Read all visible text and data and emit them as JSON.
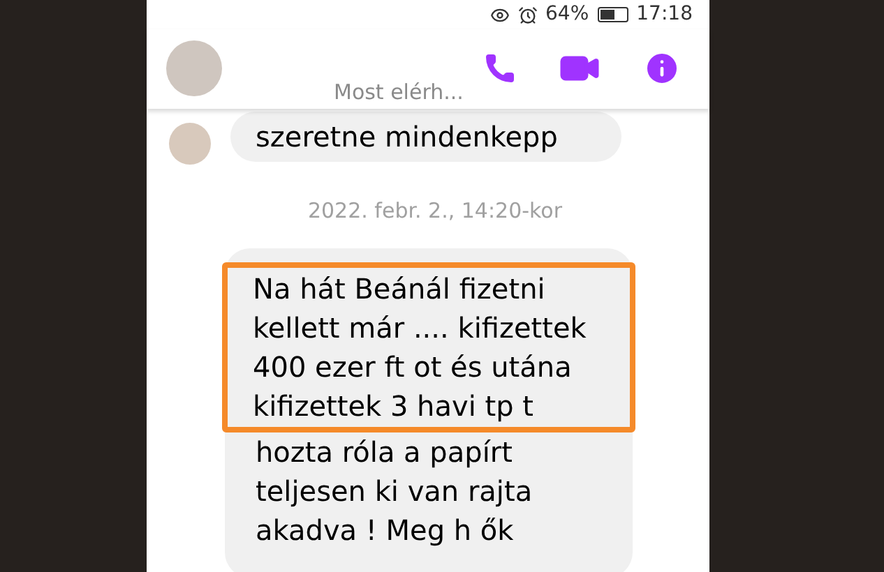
{
  "status_bar": {
    "battery": "64%",
    "time": "17:18"
  },
  "header": {
    "status": "Most elérh..."
  },
  "messages": [
    {
      "kind": "received",
      "lines": [
        {
          "text": "szeretne mindenkepp",
          "highlighted": false
        }
      ]
    },
    {
      "kind": "timestamp",
      "text": "2022. febr. 2., 14:20-kor"
    },
    {
      "kind": "received",
      "lines": [
        {
          "text": "Na hát Beánál fizetni",
          "highlighted": true
        },
        {
          "text": "kellett már .... kifizettek",
          "highlighted": true
        },
        {
          "text": "400 ezer ft ot és utána",
          "highlighted": true
        },
        {
          "text": "kifizettek 3 havi tp t",
          "highlighted": true
        },
        {
          "text": "hozta róla a papírt",
          "highlighted": false
        },
        {
          "text": "teljesen ki van rajta",
          "highlighted": false
        },
        {
          "text": "akadva ! Meg h ők",
          "highlighted": false
        }
      ]
    }
  ]
}
